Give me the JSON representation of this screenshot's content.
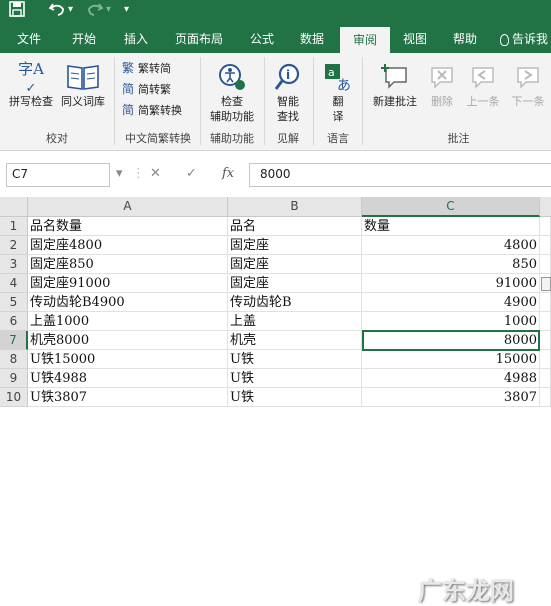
{
  "qat": {
    "save_icon": "save-icon",
    "undo_icon": "undo-icon",
    "redo_icon": "redo-icon",
    "customize": "▾"
  },
  "tabs": [
    "文件",
    "开始",
    "插入",
    "页面布局",
    "公式",
    "数据",
    "审阅",
    "视图",
    "帮助"
  ],
  "active_tab": "审阅",
  "tell_me": "告诉我",
  "ribbon": {
    "spell_check": "拼写检查",
    "thesaurus": "同义词库",
    "group_proofing": "校对",
    "trad_to_simp": "繁转简",
    "simp_to_trad": "简转繁",
    "conversion": "简繁转换",
    "group_chinese": "中文简繁转换",
    "accessibility_1": "检查",
    "accessibility_2": "辅助功能",
    "group_accessibility": "辅助功能",
    "smart_lookup_1": "智能",
    "smart_lookup_2": "查找",
    "group_insights": "见解",
    "translate_1": "翻",
    "translate_2": "译",
    "group_language": "语言",
    "new_comment": "新建批注",
    "delete": "删除",
    "previous": "上一条",
    "next": "下一条",
    "group_comments": "批注"
  },
  "formula_bar": {
    "name_box": "C7",
    "cancel": "✕",
    "enter": "✓",
    "fx": "fx",
    "value": "8000"
  },
  "grid": {
    "columns": [
      "A",
      "B",
      "C"
    ],
    "selected_column": "C",
    "selected_row": "7",
    "rows": [
      {
        "n": "1",
        "a": "品名数量",
        "b": "品名",
        "c": "数量",
        "c_text": true
      },
      {
        "n": "2",
        "a": "固定座4800",
        "b": "固定座",
        "c": "4800"
      },
      {
        "n": "3",
        "a": "固定座850",
        "b": "固定座",
        "c": "850"
      },
      {
        "n": "4",
        "a": "固定座91000",
        "b": "固定座",
        "c": "91000"
      },
      {
        "n": "5",
        "a": "传动齿轮B4900",
        "b": "传动齿轮B",
        "c": "4900"
      },
      {
        "n": "6",
        "a": "上盖1000",
        "b": "上盖",
        "c": "1000"
      },
      {
        "n": "7",
        "a": "机壳8000",
        "b": "机壳",
        "c": "8000"
      },
      {
        "n": "8",
        "a": "U铁15000",
        "b": "U铁",
        "c": "15000"
      },
      {
        "n": "9",
        "a": "U铁4988",
        "b": "U铁",
        "c": "4988"
      },
      {
        "n": "10",
        "a": "U铁3807",
        "b": "U铁",
        "c": "3807"
      }
    ]
  },
  "watermark": "广东龙网",
  "colors": {
    "accent": "#217346",
    "ribbon_bg": "#f3f3f3"
  }
}
